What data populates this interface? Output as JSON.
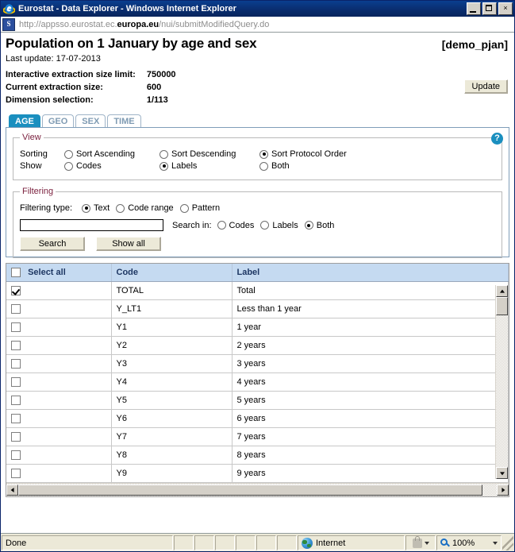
{
  "window": {
    "title": "Eurostat - Data Explorer - Windows Internet Explorer",
    "minimize_label": "Minimize",
    "maximize_label": "Maximize",
    "close_label": "×"
  },
  "address": {
    "url_prefix": "http://appsso.eurostat.ec.",
    "url_domain": "europa.eu",
    "url_suffix": "/nui/submitModifiedQuery.do"
  },
  "header": {
    "title": "Population on 1 January by age and sex",
    "dataset_code": "[demo_pjan]",
    "last_update": "Last update: 17-07-2013",
    "meta": [
      {
        "label": "Interactive extraction size limit:",
        "value": "750000"
      },
      {
        "label": "Current extraction size:",
        "value": "600"
      },
      {
        "label": "Dimension selection:",
        "value": "1/113"
      }
    ],
    "update_button": "Update"
  },
  "tabs": [
    {
      "label": "AGE",
      "active": true
    },
    {
      "label": "GEO",
      "active": false
    },
    {
      "label": "SEX",
      "active": false
    },
    {
      "label": "TIME",
      "active": false
    }
  ],
  "help": {
    "glyph": "?"
  },
  "view": {
    "legend": "View",
    "sorting_label": "Sorting",
    "sorting_options": [
      {
        "label": "Sort Ascending",
        "selected": false
      },
      {
        "label": "Sort Descending",
        "selected": false
      },
      {
        "label": "Sort Protocol Order",
        "selected": true
      }
    ],
    "show_label": "Show",
    "show_options": [
      {
        "label": "Codes",
        "selected": false
      },
      {
        "label": "Labels",
        "selected": true
      },
      {
        "label": "Both",
        "selected": false
      }
    ]
  },
  "filtering": {
    "legend": "Filtering",
    "type_label": "Filtering type:",
    "type_options": [
      {
        "label": "Text",
        "selected": true
      },
      {
        "label": "Code range",
        "selected": false
      },
      {
        "label": "Pattern",
        "selected": false
      }
    ],
    "search_value": "",
    "search_placeholder": "",
    "search_in_label": "Search in:",
    "search_in_options": [
      {
        "label": "Codes",
        "selected": false
      },
      {
        "label": "Labels",
        "selected": false
      },
      {
        "label": "Both",
        "selected": true
      }
    ],
    "search_button": "Search",
    "showall_button": "Show all"
  },
  "table": {
    "columns": [
      "Select all",
      "Code",
      "Label"
    ],
    "select_all_checked": false,
    "rows": [
      {
        "checked": true,
        "code": "TOTAL",
        "label": "Total"
      },
      {
        "checked": false,
        "code": "Y_LT1",
        "label": "Less than 1 year"
      },
      {
        "checked": false,
        "code": "Y1",
        "label": "1 year"
      },
      {
        "checked": false,
        "code": "Y2",
        "label": "2 years"
      },
      {
        "checked": false,
        "code": "Y3",
        "label": "3 years"
      },
      {
        "checked": false,
        "code": "Y4",
        "label": "4 years"
      },
      {
        "checked": false,
        "code": "Y5",
        "label": "5 years"
      },
      {
        "checked": false,
        "code": "Y6",
        "label": "6 years"
      },
      {
        "checked": false,
        "code": "Y7",
        "label": "7 years"
      },
      {
        "checked": false,
        "code": "Y8",
        "label": "8 years"
      },
      {
        "checked": false,
        "code": "Y9",
        "label": "9 years"
      }
    ]
  },
  "statusbar": {
    "status": "Done",
    "zone": "Internet",
    "zoom": "100%"
  }
}
